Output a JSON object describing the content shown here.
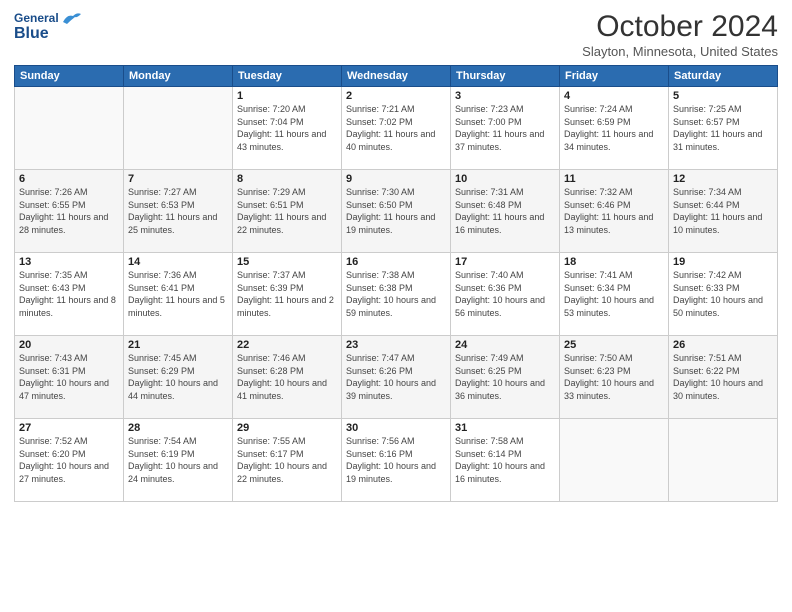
{
  "header": {
    "logo_general": "General",
    "logo_blue": "Blue",
    "title": "October 2024",
    "location": "Slayton, Minnesota, United States"
  },
  "days_of_week": [
    "Sunday",
    "Monday",
    "Tuesday",
    "Wednesday",
    "Thursday",
    "Friday",
    "Saturday"
  ],
  "weeks": [
    [
      {
        "day": "",
        "info": ""
      },
      {
        "day": "",
        "info": ""
      },
      {
        "day": "1",
        "info": "Sunrise: 7:20 AM\nSunset: 7:04 PM\nDaylight: 11 hours and 43 minutes."
      },
      {
        "day": "2",
        "info": "Sunrise: 7:21 AM\nSunset: 7:02 PM\nDaylight: 11 hours and 40 minutes."
      },
      {
        "day": "3",
        "info": "Sunrise: 7:23 AM\nSunset: 7:00 PM\nDaylight: 11 hours and 37 minutes."
      },
      {
        "day": "4",
        "info": "Sunrise: 7:24 AM\nSunset: 6:59 PM\nDaylight: 11 hours and 34 minutes."
      },
      {
        "day": "5",
        "info": "Sunrise: 7:25 AM\nSunset: 6:57 PM\nDaylight: 11 hours and 31 minutes."
      }
    ],
    [
      {
        "day": "6",
        "info": "Sunrise: 7:26 AM\nSunset: 6:55 PM\nDaylight: 11 hours and 28 minutes."
      },
      {
        "day": "7",
        "info": "Sunrise: 7:27 AM\nSunset: 6:53 PM\nDaylight: 11 hours and 25 minutes."
      },
      {
        "day": "8",
        "info": "Sunrise: 7:29 AM\nSunset: 6:51 PM\nDaylight: 11 hours and 22 minutes."
      },
      {
        "day": "9",
        "info": "Sunrise: 7:30 AM\nSunset: 6:50 PM\nDaylight: 11 hours and 19 minutes."
      },
      {
        "day": "10",
        "info": "Sunrise: 7:31 AM\nSunset: 6:48 PM\nDaylight: 11 hours and 16 minutes."
      },
      {
        "day": "11",
        "info": "Sunrise: 7:32 AM\nSunset: 6:46 PM\nDaylight: 11 hours and 13 minutes."
      },
      {
        "day": "12",
        "info": "Sunrise: 7:34 AM\nSunset: 6:44 PM\nDaylight: 11 hours and 10 minutes."
      }
    ],
    [
      {
        "day": "13",
        "info": "Sunrise: 7:35 AM\nSunset: 6:43 PM\nDaylight: 11 hours and 8 minutes."
      },
      {
        "day": "14",
        "info": "Sunrise: 7:36 AM\nSunset: 6:41 PM\nDaylight: 11 hours and 5 minutes."
      },
      {
        "day": "15",
        "info": "Sunrise: 7:37 AM\nSunset: 6:39 PM\nDaylight: 11 hours and 2 minutes."
      },
      {
        "day": "16",
        "info": "Sunrise: 7:38 AM\nSunset: 6:38 PM\nDaylight: 10 hours and 59 minutes."
      },
      {
        "day": "17",
        "info": "Sunrise: 7:40 AM\nSunset: 6:36 PM\nDaylight: 10 hours and 56 minutes."
      },
      {
        "day": "18",
        "info": "Sunrise: 7:41 AM\nSunset: 6:34 PM\nDaylight: 10 hours and 53 minutes."
      },
      {
        "day": "19",
        "info": "Sunrise: 7:42 AM\nSunset: 6:33 PM\nDaylight: 10 hours and 50 minutes."
      }
    ],
    [
      {
        "day": "20",
        "info": "Sunrise: 7:43 AM\nSunset: 6:31 PM\nDaylight: 10 hours and 47 minutes."
      },
      {
        "day": "21",
        "info": "Sunrise: 7:45 AM\nSunset: 6:29 PM\nDaylight: 10 hours and 44 minutes."
      },
      {
        "day": "22",
        "info": "Sunrise: 7:46 AM\nSunset: 6:28 PM\nDaylight: 10 hours and 41 minutes."
      },
      {
        "day": "23",
        "info": "Sunrise: 7:47 AM\nSunset: 6:26 PM\nDaylight: 10 hours and 39 minutes."
      },
      {
        "day": "24",
        "info": "Sunrise: 7:49 AM\nSunset: 6:25 PM\nDaylight: 10 hours and 36 minutes."
      },
      {
        "day": "25",
        "info": "Sunrise: 7:50 AM\nSunset: 6:23 PM\nDaylight: 10 hours and 33 minutes."
      },
      {
        "day": "26",
        "info": "Sunrise: 7:51 AM\nSunset: 6:22 PM\nDaylight: 10 hours and 30 minutes."
      }
    ],
    [
      {
        "day": "27",
        "info": "Sunrise: 7:52 AM\nSunset: 6:20 PM\nDaylight: 10 hours and 27 minutes."
      },
      {
        "day": "28",
        "info": "Sunrise: 7:54 AM\nSunset: 6:19 PM\nDaylight: 10 hours and 24 minutes."
      },
      {
        "day": "29",
        "info": "Sunrise: 7:55 AM\nSunset: 6:17 PM\nDaylight: 10 hours and 22 minutes."
      },
      {
        "day": "30",
        "info": "Sunrise: 7:56 AM\nSunset: 6:16 PM\nDaylight: 10 hours and 19 minutes."
      },
      {
        "day": "31",
        "info": "Sunrise: 7:58 AM\nSunset: 6:14 PM\nDaylight: 10 hours and 16 minutes."
      },
      {
        "day": "",
        "info": ""
      },
      {
        "day": "",
        "info": ""
      }
    ]
  ]
}
